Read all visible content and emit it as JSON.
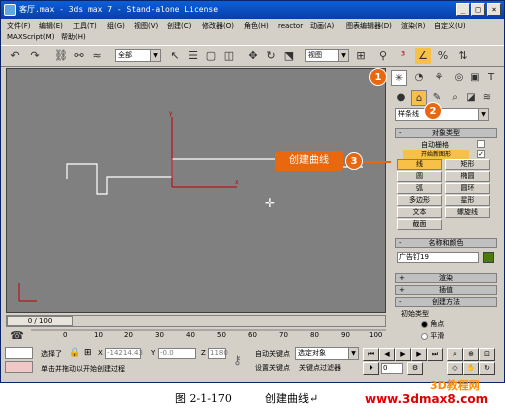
{
  "window": {
    "title": "客厅.max - 3ds max 7  - Stand-alone License",
    "min": "_",
    "max": "□",
    "close": "×"
  },
  "menu": [
    "文件(F)",
    "编辑(E)",
    "工具(T)",
    "组(G)",
    "视图(V)",
    "创建(C)",
    "修改器(O)",
    "角色(H)",
    "reactor",
    "动画(A)",
    "图表编辑器(D)",
    "渲染(R)",
    "自定义(U)",
    "MAXScript(M)",
    "帮助(H)"
  ],
  "toolbar": {
    "selection_filter": "全部",
    "ref_coord": "视图"
  },
  "viewport": {
    "label": ""
  },
  "command_panel": {
    "category_dropdown": "样条线",
    "object_type_header": "对象类型",
    "auto_grid": "自动栅格",
    "start_new_shape": "开始新图形",
    "buttons": [
      [
        "线",
        "矩形"
      ],
      [
        "圆",
        "椭圆"
      ],
      [
        "弧",
        "圆环"
      ],
      [
        "多边形",
        "星形"
      ],
      [
        "文本",
        "螺旋线"
      ],
      [
        "截面",
        ""
      ]
    ],
    "name_color_header": "名称和颜色",
    "name_value": "广告钉19",
    "render_header": "渲染",
    "interp_header": "插值",
    "creation_method_header": "创建方法",
    "initial_type": "初始类型",
    "radio_corner": "角点",
    "radio_smooth": "平滑"
  },
  "timeline": {
    "frame_text": "0 / 100"
  },
  "trackbar": {
    "ticks": [
      "0",
      "10",
      "20",
      "30",
      "40",
      "50",
      "60",
      "70",
      "80",
      "90",
      "100"
    ]
  },
  "status": {
    "selected": "选择了",
    "x_label": "X",
    "x_value": "-14214.43",
    "y_label": "Y",
    "y_value": "-0.0",
    "z_label": "Z",
    "z_value": "1180",
    "auto_key": "自动关键点",
    "selected_object": "选定对象",
    "set_key": "设置关键点",
    "key_filters": "关键点过滤器",
    "prompt": "单击并拖动以开始创建过程",
    "frame_field": "0"
  },
  "annotations": {
    "callout": "创建曲线",
    "m1": "1",
    "m2": "2",
    "m3": "3"
  },
  "caption": {
    "figure": "图 2-1-170",
    "text": "创建曲线↵"
  },
  "watermark": {
    "url": "www.3dmax8.com",
    "logo": "3D教程网"
  },
  "colors": {
    "accent": "#e86810",
    "active_button": "#f7c046",
    "viewport_bg": "#808080",
    "title_blue": "#0a3ea8"
  }
}
